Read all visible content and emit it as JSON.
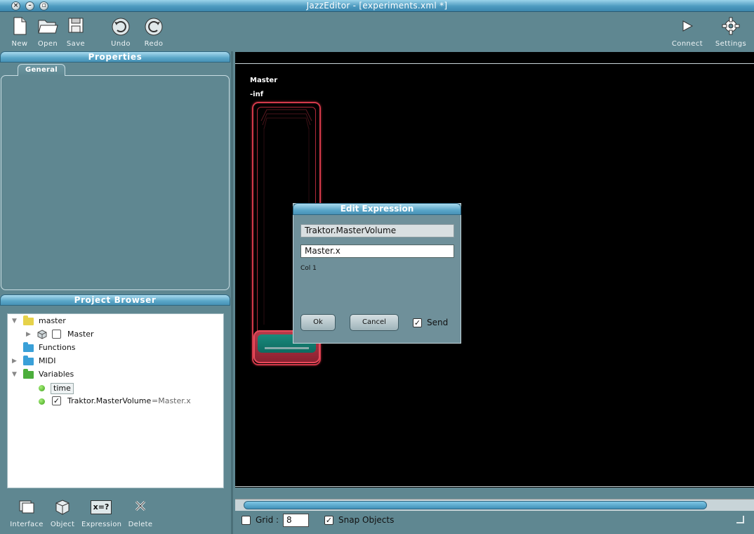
{
  "window": {
    "title": "JazzEditor - [experiments.xml *]"
  },
  "toolbar": {
    "new": "New",
    "open": "Open",
    "save": "Save",
    "undo": "Undo",
    "redo": "Redo",
    "connect": "Connect",
    "settings": "Settings"
  },
  "properties": {
    "title": "Properties",
    "tab": "General"
  },
  "browser": {
    "title": "Project Browser",
    "tree": {
      "master": "master",
      "master_child": "Master",
      "functions": "Functions",
      "midi": "MIDI",
      "variables": "Variables",
      "var_time": "time",
      "var_traktor": "Traktor.MasterVolume",
      "var_traktor_expr": "=Master.x"
    },
    "tools": {
      "interface": "Interface",
      "object": "Object",
      "expression": "Expression",
      "delete": "Delete",
      "expression_icon_text": "x=?"
    }
  },
  "canvas": {
    "widget_label": "Master",
    "widget_value": "-inf"
  },
  "dialog": {
    "title": "Edit Expression",
    "name_value": "Traktor.MasterVolume",
    "expr_value": "Master.x",
    "col_text": "Col 1",
    "ok": "Ok",
    "cancel": "Cancel",
    "send": "Send",
    "send_checked": true
  },
  "statusbar": {
    "grid_label": "Grid :",
    "grid_value": "8",
    "snap_label": "Snap Objects",
    "grid_checked": false,
    "snap_checked": true
  },
  "colors": {
    "background": "#5f8791",
    "accent": "#4a9cc2",
    "widget_red": "#d33a4a",
    "widget_teal": "#0d6a60"
  }
}
